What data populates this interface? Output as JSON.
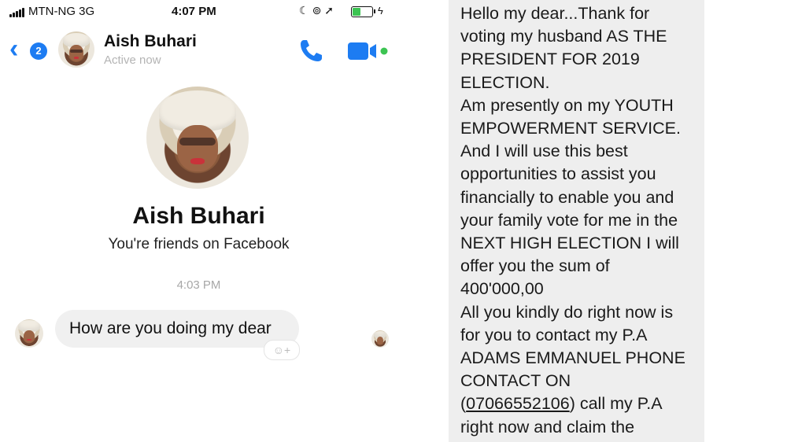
{
  "status_bar": {
    "carrier": "MTN-NG  3G",
    "time": "4:07 PM",
    "battery_level": 0.4,
    "colors": {
      "battery_fill": "#3cc452"
    }
  },
  "header": {
    "unread_count": "2",
    "contact_name": "Aish Buhari",
    "presence": "Active now",
    "icons": [
      "chevron-left-icon",
      "phone-icon",
      "video-camera-icon"
    ],
    "accent_color": "#1d7cf2"
  },
  "profile": {
    "name": "Aish Buhari",
    "relation": "You're friends on Facebook"
  },
  "conversation": {
    "timestamp": "4:03 PM",
    "messages": [
      {
        "text": "How are you doing my dear"
      }
    ],
    "reaction_button_label": "☺+"
  },
  "long_message": {
    "lines": [
      "Hello my dear...Thank for",
      "voting my husband AS THE",
      "PRESIDENT FOR 2019",
      "ELECTION.",
      "Am presently on my YOUTH",
      "EMPOWERMENT SERVICE.",
      "And I will use this best",
      "opportunities to assist you",
      "financially to enable you and",
      "your family vote for me in the",
      "NEXT HIGH ELECTION I will",
      "offer you the sum of",
      "400'000,00",
      "All you kindly do right now is",
      "for you to contact my P.A",
      "ADAMS EMMANUEL PHONE",
      "CONTACT ON"
    ],
    "phone_open": "(",
    "phone_number": "07066552106",
    "phone_close": ") call my P.A",
    "last_line": "right now and claim the"
  }
}
